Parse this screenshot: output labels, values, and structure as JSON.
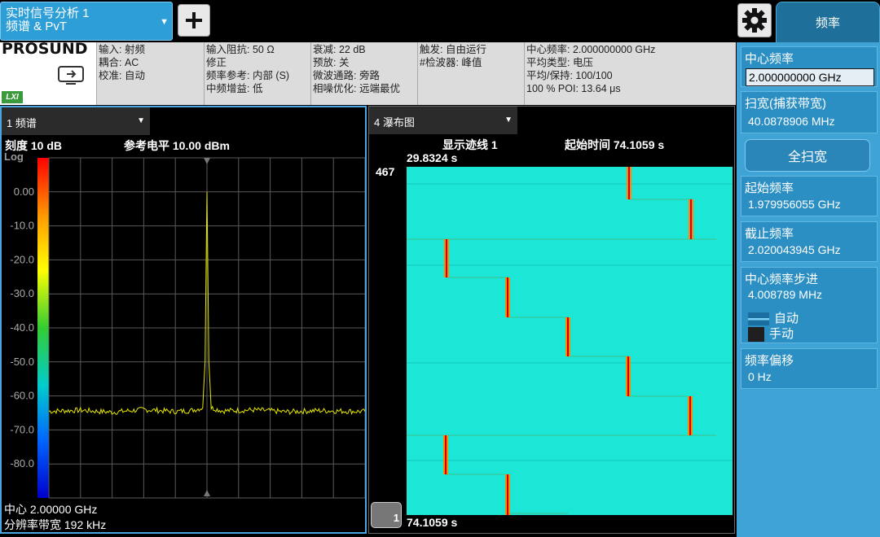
{
  "mode": {
    "line1": "实时信号分析 1",
    "line2": "频谱 & PvT"
  },
  "menu_tab": "频率",
  "logo": {
    "brand": "PROSUND",
    "lxi": "LXI"
  },
  "info": {
    "col1": [
      "输入: 射频",
      "耦合: AC",
      "校准: 自动"
    ],
    "col2": [
      "输入阻抗: 50 Ω",
      "修正",
      "频率参考: 内部 (S)",
      "中频增益: 低"
    ],
    "col3": [
      "衰减: 22 dB",
      "预放: 关",
      "微波通路: 旁路",
      "相噪优化: 远端最优"
    ],
    "col4": [
      "触发: 自由运行",
      "#检波器: 峰值"
    ],
    "col5": [
      "中心频率: 2.000000000 GHz",
      "平均类型: 电压",
      "平均/保持: 100/100",
      "100 % POI: 13.64 μs"
    ]
  },
  "left_panel": {
    "trace_select": "1 频谱",
    "scale": "刻度 10 dB",
    "ref_level": "参考电平 10.00 dBm",
    "log": "Log",
    "y_ticks": [
      "0.00",
      "-10.0",
      "-20.0",
      "-30.0",
      "-40.0",
      "-50.0",
      "-60.0",
      "-70.0",
      "-80.0"
    ],
    "center": "中心 2.00000 GHz",
    "rbw": "分辨率带宽 192 kHz"
  },
  "right_panel": {
    "trace_select": "4 瀑布图",
    "display_trace": "显示迹线 1",
    "start_time": "起始时间 74.1059 s",
    "top_time": "29.8324 s",
    "count": "467",
    "bottom_time": "74.1059 s",
    "marker": "1"
  },
  "sidebar": {
    "center_freq": {
      "label": "中心频率",
      "value": "2.000000000 GHz"
    },
    "span": {
      "label": "扫宽(捕获带宽)",
      "value": "40.0878906 MHz"
    },
    "full_span": "全扫宽",
    "start_freq": {
      "label": "起始频率",
      "value": "1.979956055 GHz"
    },
    "stop_freq": {
      "label": "截止频率",
      "value": "2.020043945 GHz"
    },
    "cf_step": {
      "label": "中心频率步进",
      "value": "4.008789 MHz",
      "auto": "自动",
      "manual": "手动"
    },
    "freq_offset": {
      "label": "频率偏移",
      "value": "0 Hz"
    }
  },
  "chart_data": [
    {
      "type": "line",
      "ylabel": "",
      "ylim": [
        -90,
        10
      ],
      "y_ticks": [
        0,
        -10,
        -20,
        -30,
        -40,
        -50,
        -60,
        -70,
        -80
      ],
      "x": [
        1.97996,
        1.98396,
        1.98796,
        1.99196,
        1.99596,
        1.99796,
        1.99946,
        1.99976,
        2.0,
        2.00024,
        2.00054,
        2.00204,
        2.00604,
        2.01004,
        2.01404,
        2.02004
      ],
      "series": [
        {
          "values": [
            -64.5,
            -64.2,
            -64.8,
            -64.0,
            -64.6,
            -64.3,
            -63.5,
            -50,
            0.0,
            -50,
            -63.5,
            -64.4,
            -64.1,
            -64.7,
            -64.3,
            -64.6
          ]
        }
      ],
      "colors": {
        "trace": "#e6e600",
        "grid": "#5a5a5a"
      }
    }
  ]
}
